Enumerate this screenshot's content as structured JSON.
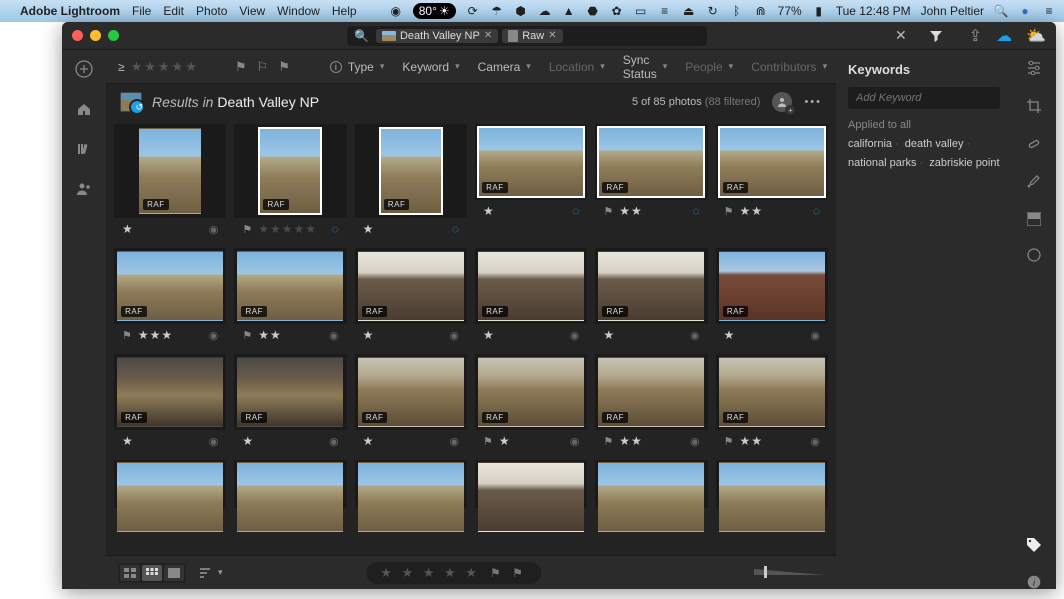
{
  "menubar": {
    "app": "Adobe Lightroom",
    "items": [
      "File",
      "Edit",
      "Photo",
      "View",
      "Window",
      "Help"
    ],
    "temp": "80°",
    "battery": "77%",
    "clock": "Tue 12:48 PM",
    "user": "John Peltier"
  },
  "search": {
    "chip1_label": "Death Valley NP",
    "chip2_label": "Raw"
  },
  "filter": {
    "rating_op": "≥",
    "type": "Type",
    "keyword": "Keyword",
    "camera": "Camera",
    "location": "Location",
    "sync": "Sync Status",
    "people": "People",
    "contributors": "Contributors"
  },
  "results": {
    "prefix": "Results in",
    "album": "Death Valley NP",
    "count": "5 of 85 photos",
    "filtered": "(88 filtered)"
  },
  "keywords": {
    "title": "Keywords",
    "placeholder": "Add Keyword",
    "applied": "Applied to all",
    "tags": [
      "california",
      "death valley",
      "national parks",
      "zabriskie point"
    ]
  },
  "badge": "RAF",
  "thumbs": [
    {
      "orient": "portrait",
      "variant": "",
      "rating": 1,
      "flag": false,
      "sync": "check",
      "sel": false
    },
    {
      "orient": "portrait",
      "variant": "",
      "rating": 1,
      "flag": true,
      "sync": "sync",
      "dim": true,
      "sel": true
    },
    {
      "orient": "portrait",
      "variant": "",
      "rating": 1,
      "flag": false,
      "sync": "sync",
      "sel": true
    },
    {
      "orient": "landscape",
      "variant": "",
      "rating": 1,
      "flag": false,
      "sync": "sync",
      "sel": true
    },
    {
      "orient": "landscape",
      "variant": "",
      "rating": 2,
      "flag": true,
      "sync": "sync",
      "sel": true
    },
    {
      "orient": "landscape",
      "variant": "",
      "rating": 2,
      "flag": true,
      "sync": "sync",
      "sel": true
    },
    {
      "orient": "landscape",
      "variant": "",
      "rating": 3,
      "flag": true,
      "sync": "check"
    },
    {
      "orient": "landscape",
      "variant": "",
      "rating": 2,
      "flag": true,
      "sync": "check"
    },
    {
      "orient": "landscape",
      "variant": "sunset",
      "rating": 1,
      "flag": false,
      "sync": "check"
    },
    {
      "orient": "landscape",
      "variant": "sunset",
      "rating": 1,
      "flag": false,
      "sync": "check"
    },
    {
      "orient": "landscape",
      "variant": "sunset",
      "rating": 1,
      "flag": false,
      "sync": "check"
    },
    {
      "orient": "landscape",
      "variant": "red",
      "rating": 1,
      "flag": false,
      "sync": "check"
    },
    {
      "orient": "landscape",
      "variant": "dark",
      "rating": 1,
      "flag": false,
      "sync": "check"
    },
    {
      "orient": "landscape",
      "variant": "dark",
      "rating": 1,
      "flag": false,
      "sync": "check"
    },
    {
      "orient": "landscape",
      "variant": "warm",
      "rating": 1,
      "flag": false,
      "sync": "check"
    },
    {
      "orient": "landscape",
      "variant": "warm",
      "rating": 1,
      "flag": true,
      "sync": "check"
    },
    {
      "orient": "landscape",
      "variant": "warm",
      "rating": 2,
      "flag": true,
      "sync": "check"
    },
    {
      "orient": "landscape",
      "variant": "warm",
      "rating": 2,
      "flag": true,
      "sync": "check"
    },
    {
      "orient": "landscape",
      "variant": "",
      "rating": 0,
      "flag": false,
      "sync": ""
    },
    {
      "orient": "landscape",
      "variant": "",
      "rating": 0,
      "flag": false,
      "sync": ""
    },
    {
      "orient": "landscape",
      "variant": "",
      "rating": 0,
      "flag": false,
      "sync": ""
    },
    {
      "orient": "landscape",
      "variant": "sunset",
      "rating": 0,
      "flag": false,
      "sync": ""
    },
    {
      "orient": "landscape",
      "variant": "",
      "rating": 0,
      "flag": false,
      "sync": ""
    },
    {
      "orient": "landscape",
      "variant": "",
      "rating": 0,
      "flag": false,
      "sync": ""
    }
  ]
}
